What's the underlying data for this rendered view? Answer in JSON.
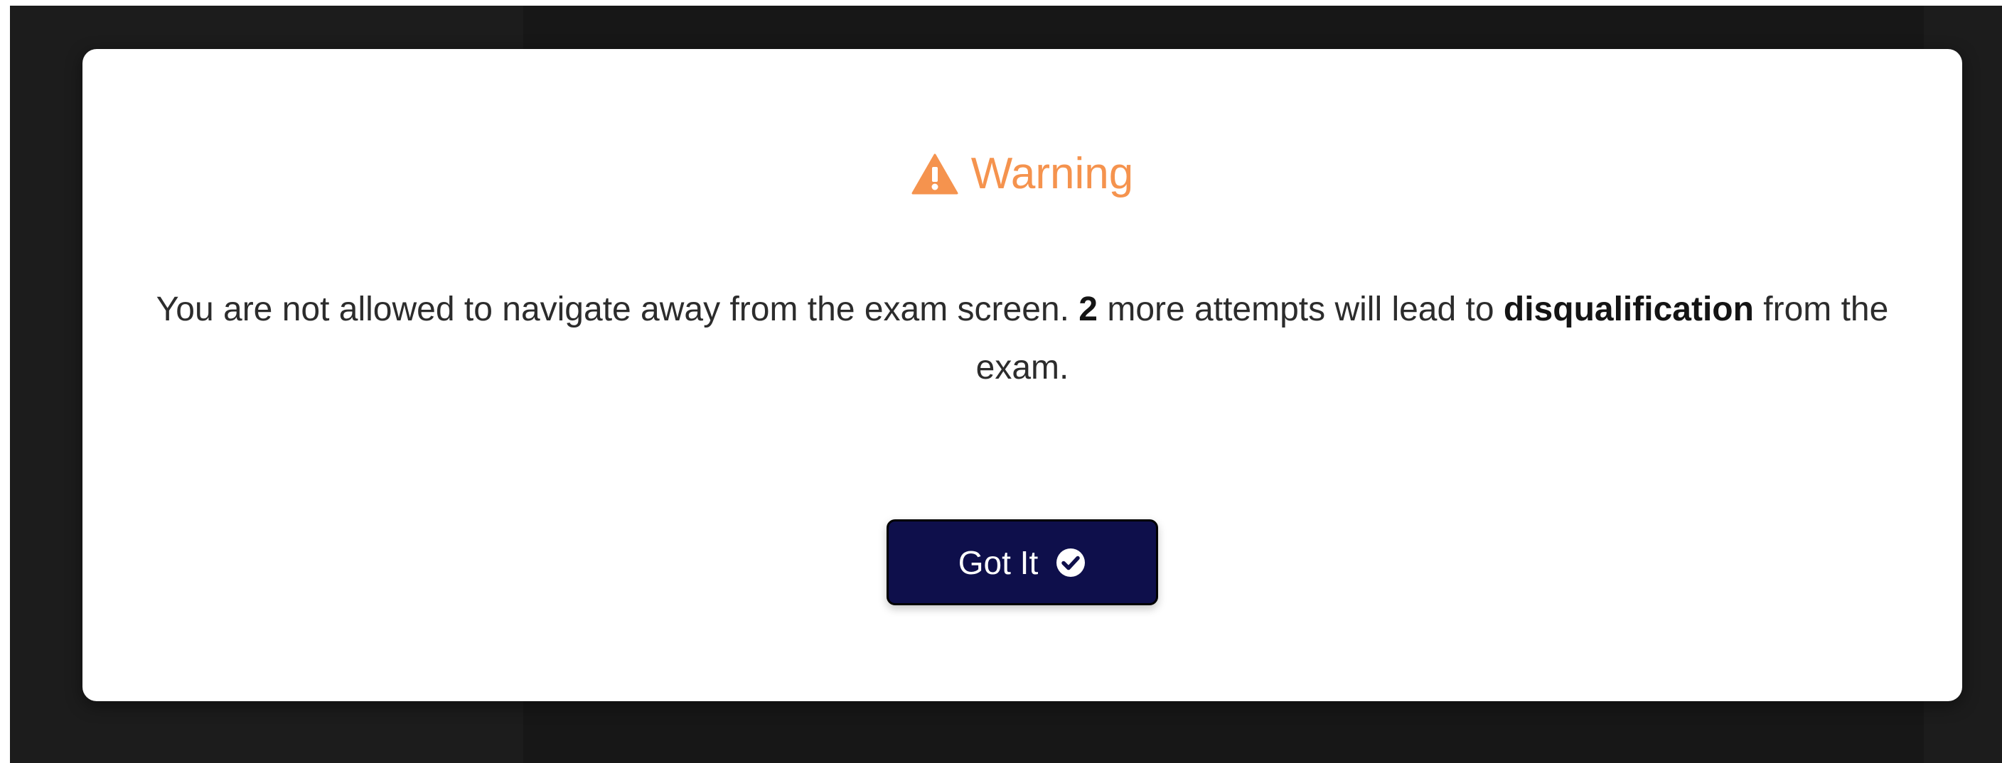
{
  "dialog": {
    "title": "Warning",
    "title_icon": "warning-triangle-icon",
    "title_color": "#f5934e",
    "message": {
      "part1": "You are not allowed to navigate away from the exam screen. ",
      "attempts_count": "2",
      "part2": " more attempts will lead to ",
      "emphasis": "disqualification",
      "part3": " from the exam."
    },
    "confirm_button": {
      "label": "Got It",
      "icon": "check-circle-icon",
      "background": "#0e0f4b"
    }
  }
}
